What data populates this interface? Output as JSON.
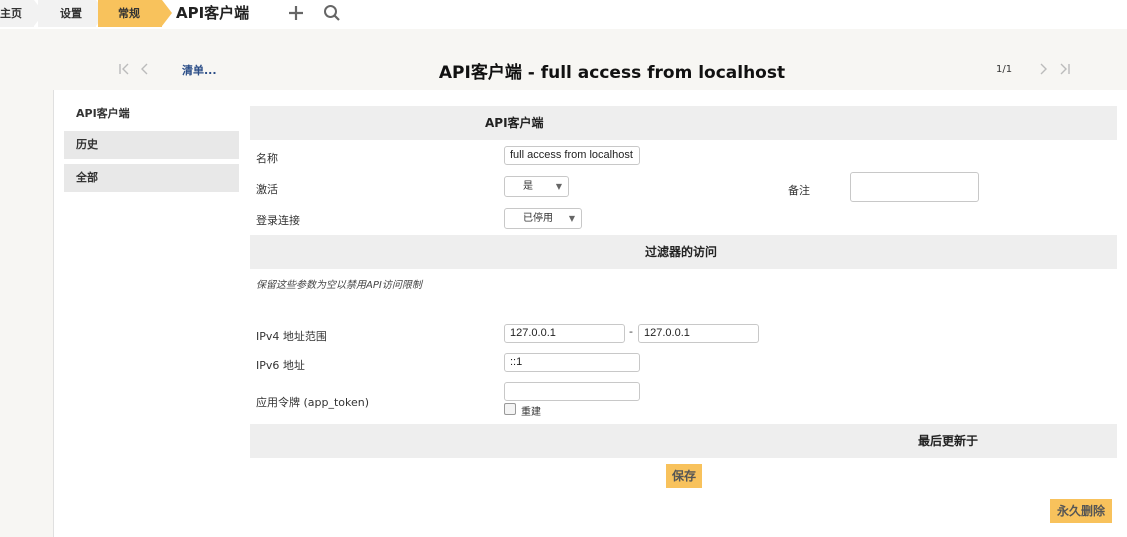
{
  "breadcrumb": {
    "home": "主页",
    "settings": "设置",
    "general": "常规",
    "current": "API客户端"
  },
  "colors": {
    "accent": "#f8c25c",
    "link": "#2b4d87",
    "section_bg": "#eeeeee"
  },
  "toolbar_icons": [
    "plus-icon",
    "search-icon"
  ],
  "nav": {
    "list_link": "清单...",
    "record_title": "API客户端 - full access from localhost",
    "pager": "1/1"
  },
  "tabs": {
    "main": "API客户端",
    "history": "历史",
    "all": "全部"
  },
  "form": {
    "section1": "API客户端",
    "name_label": "名称",
    "name_value": "full access from localhost",
    "active_label": "激活",
    "active_value": "是",
    "comment_label": "备注",
    "log_label": "登录连接",
    "log_value": "已停用",
    "section2": "过滤器的访问",
    "hint": "保留这些参数为空以禁用API访问限制",
    "ipv4_label": "IPv4 地址范围",
    "ipv4_start": "127.0.0.1",
    "ipv4_sep": "-",
    "ipv4_end": "127.0.0.1",
    "ipv6_label": "IPv6 地址",
    "ipv6_value": "::1",
    "token_label": "应用令牌 (app_token)",
    "token_value": "",
    "regenerate_label": "重建",
    "section3": "最后更新于"
  },
  "buttons": {
    "save": "保存",
    "delete": "永久删除"
  }
}
